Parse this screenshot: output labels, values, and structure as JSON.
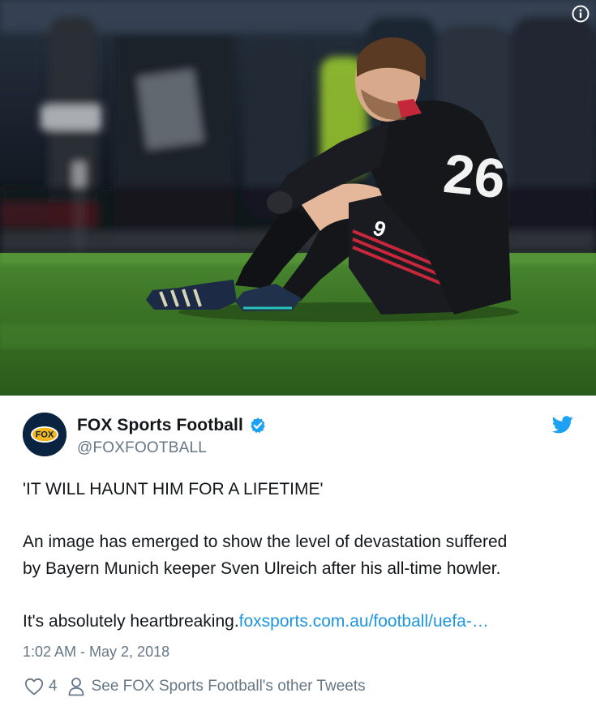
{
  "media": {
    "info_icon": "info-circle-icon",
    "jersey_number": "26",
    "shorts_number": "9"
  },
  "author": {
    "avatar_text": "FOX",
    "display_name": "FOX Sports Football",
    "handle": "@FOXFOOTBALL",
    "verified_icon": "verified-badge-icon"
  },
  "brand_icon": "twitter-bird-icon",
  "tweet": {
    "headline": "'IT WILL HAUNT HIM FOR A LIFETIME'",
    "body_line_1": "An image has emerged to show the level of devastation suffered",
    "body_line_2": "by Bayern Munich keeper Sven Ulreich after his all-time howler.",
    "closing_text": "It's absolutely heartbreaking.",
    "link_text": "foxsports.com.au/football/uefa-…"
  },
  "timestamp": "1:02 AM - May 2, 2018",
  "actions": {
    "like_count": "4",
    "other_tweets_label": "See FOX Sports Football's other Tweets"
  },
  "colors": {
    "link_blue": "#1b95e0",
    "muted_gray": "#657786",
    "text_dark": "#14171a",
    "avatar_navy": "#0a2340"
  }
}
